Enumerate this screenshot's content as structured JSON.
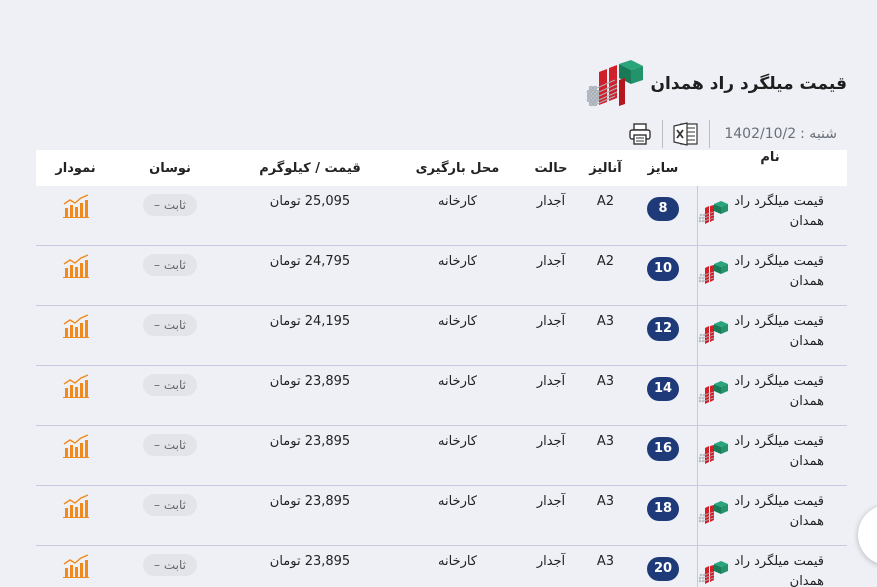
{
  "header": {
    "title": "قیمت میلگرد راد همدان",
    "date_label": "شنبه :",
    "date_value": "1402/10/2"
  },
  "table": {
    "columns": {
      "name": "نام",
      "size": "سایز",
      "analysis": "آنالیز",
      "state": "حالت",
      "place": "محل بارگیری",
      "price": "قیمت / کیلوگرم",
      "volatility": "نوسان",
      "chart": "نمودار"
    },
    "rows": [
      {
        "name": "قیمت میلگرد راد همدان",
        "size": "8",
        "analysis": "A2",
        "state": "آجدار",
        "place": "کارخانه",
        "price": "25,095 تومان",
        "volatility": "ثابت –"
      },
      {
        "name": "قیمت میلگرد راد همدان",
        "size": "10",
        "analysis": "A2",
        "state": "آجدار",
        "place": "کارخانه",
        "price": "24,795 تومان",
        "volatility": "ثابت –"
      },
      {
        "name": "قیمت میلگرد راد همدان",
        "size": "12",
        "analysis": "A3",
        "state": "آجدار",
        "place": "کارخانه",
        "price": "24,195 تومان",
        "volatility": "ثابت –"
      },
      {
        "name": "قیمت میلگرد راد همدان",
        "size": "14",
        "analysis": "A3",
        "state": "آجدار",
        "place": "کارخانه",
        "price": "23,895 تومان",
        "volatility": "ثابت –"
      },
      {
        "name": "قیمت میلگرد راد همدان",
        "size": "16",
        "analysis": "A3",
        "state": "آجدار",
        "place": "کارخانه",
        "price": "23,895 تومان",
        "volatility": "ثابت –"
      },
      {
        "name": "قیمت میلگرد راد همدان",
        "size": "18",
        "analysis": "A3",
        "state": "آجدار",
        "place": "کارخانه",
        "price": "23,895 تومان",
        "volatility": "ثابت –"
      },
      {
        "name": "قیمت میلگرد راد همدان",
        "size": "20",
        "analysis": "A3",
        "state": "آجدار",
        "place": "کارخانه",
        "price": "23,895 تومان",
        "volatility": "ثابت –"
      }
    ]
  },
  "icons": {
    "logo": "rebar-logo-icon",
    "print": "printer-icon",
    "excel": "excel-icon",
    "chart": "bar-chart-icon"
  },
  "colors": {
    "badge": "#1f3a78",
    "accent_red": "#d0202a",
    "accent_green": "#1f8a63",
    "chart_orange": "#f08a1c"
  }
}
